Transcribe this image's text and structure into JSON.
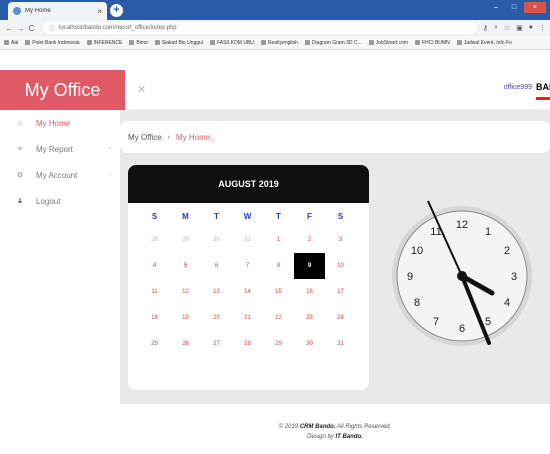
{
  "browser": {
    "tab_title": "My Home",
    "tab_close": "×",
    "new_tab": "+",
    "window_controls": [
      "–",
      "□",
      "×"
    ],
    "nav": [
      "←",
      "→",
      "C"
    ],
    "url": "localhost/bando.com/report_office/index.php",
    "bookmarks": [
      "Aal",
      "Point Bank Indonesia",
      "INFERENCE",
      "Bimo",
      "Siakad Bio Unggul",
      "FASILKOM UBU",
      "Realtyenglish",
      "Diagram Gram 3D C...",
      "JobStreet.com",
      "FHCI BUMN",
      "Jadwal Event, Info Fo"
    ]
  },
  "app": {
    "brand": "My Office",
    "expand_icon": "✕",
    "user": "office999",
    "badge": "BAN"
  },
  "sidebar": {
    "items": [
      {
        "label": "My Home",
        "icon": "home-icon"
      },
      {
        "label": "My Report",
        "icon": "report-icon"
      },
      {
        "label": "My Account",
        "icon": "account-icon"
      },
      {
        "label": "Logout",
        "icon": "user-icon"
      }
    ]
  },
  "breadcrumb": {
    "root": "My Office",
    "sep": "›",
    "current": "My Home.."
  },
  "calendar": {
    "title": "AUGUST 2019",
    "weekdays": [
      "S",
      "M",
      "T",
      "W",
      "T",
      "F",
      "S"
    ],
    "days": [
      "28",
      "29",
      "30",
      "31",
      "1",
      "2",
      "3",
      "4",
      "5",
      "6",
      "7",
      "8",
      "9",
      "10",
      "11",
      "12",
      "13",
      "14",
      "15",
      "16",
      "17",
      "18",
      "19",
      "20",
      "21",
      "22",
      "23",
      "24",
      "25",
      "26",
      "27",
      "28",
      "29",
      "30",
      "31"
    ],
    "selected": "9"
  },
  "clock": {
    "numbers": [
      "12",
      "1",
      "2",
      "3",
      "4",
      "5",
      "6",
      "7",
      "8",
      "9",
      "10",
      "11"
    ]
  },
  "footer": {
    "line1_pre": "© 2019",
    "line1_brand": "CRM Bando.",
    "line1_post": "All Rights Reserved.",
    "line2_pre": "Design by",
    "line2_brand": "IT Bando."
  },
  "colors": {
    "accent": "#e05a66",
    "tabstrip": "#2a5ba8",
    "weekday": "#1f3fb7"
  }
}
